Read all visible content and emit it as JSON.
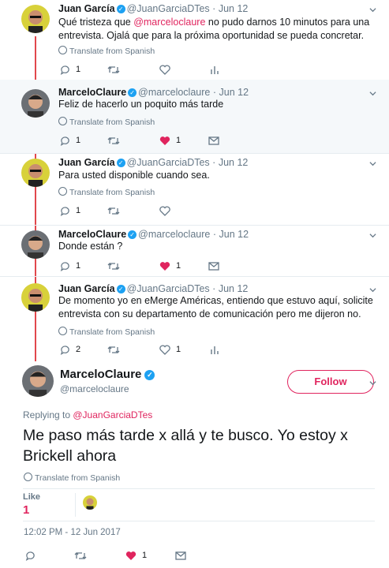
{
  "tweets": [
    {
      "name": "Juan García",
      "handle": "@JuanGarciaDTes",
      "time": "Jun 12",
      "text_before": "Qué tristeza que ",
      "mention": "@marceloclaure",
      "text_after": " no pudo darnos 10 minutos para una entrevista. Ojalá que para la próxima oportunidad se pueda concretar.",
      "translate": "Translate from Spanish",
      "replies": "1",
      "retweets": "",
      "likes": ""
    },
    {
      "name": "MarceloClaure",
      "handle": "@marceloclaure",
      "time": "Jun 12",
      "text": "Feliz de hacerlo un poquito más tarde",
      "translate": "Translate from Spanish",
      "replies": "1",
      "retweets": "",
      "likes": "1"
    },
    {
      "name": "Juan García",
      "handle": "@JuanGarciaDTes",
      "time": "Jun 12",
      "text": "Para usted disponible cuando sea.",
      "translate": "Translate from Spanish",
      "replies": "1",
      "retweets": "",
      "likes": ""
    },
    {
      "name": "MarceloClaure",
      "handle": "@marceloclaure",
      "time": "Jun 12",
      "text": "Donde están ?",
      "replies": "1",
      "retweets": "",
      "likes": "1"
    },
    {
      "name": "Juan García",
      "handle": "@JuanGarciaDTes",
      "time": "Jun 12",
      "text": "De momento yo en eMerge Américas, entiendo que estuvo aquí, solicite entrevista con su departamento de comunicación pero me dijeron no.",
      "translate": "Translate from Spanish",
      "replies": "2",
      "retweets": "",
      "likes": "1"
    }
  ],
  "main": {
    "name": "MarceloClaure",
    "handle": "@marceloclaure",
    "follow_label": "Follow",
    "replying_prefix": "Replying to ",
    "replying_to": "@JuanGarciaDTes",
    "text": "Me paso más tarde x allá y te busco. Yo estoy x Brickell ahora",
    "translate": "Translate from Spanish",
    "like_label": "Like",
    "like_count": "1",
    "timestamp": "12:02 PM - 12 Jun 2017",
    "replies": "",
    "retweets": "",
    "likes": "1"
  },
  "verified_mark": "✓",
  "sep": "·",
  "colors": {
    "accent": "#e0245e",
    "link": "#1da1f2",
    "thread": "#e1484c",
    "muted": "#657786"
  }
}
